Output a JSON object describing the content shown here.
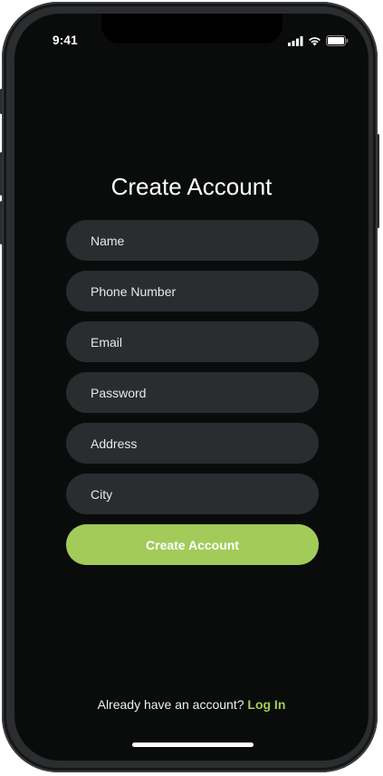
{
  "status_bar": {
    "time": "9:41",
    "icons": [
      "signal-icon",
      "wifi-icon",
      "battery-icon"
    ]
  },
  "form": {
    "title": "Create Account",
    "fields": [
      {
        "placeholder": "Name"
      },
      {
        "placeholder": "Phone Number"
      },
      {
        "placeholder": "Email"
      },
      {
        "placeholder": "Password"
      },
      {
        "placeholder": "Address"
      },
      {
        "placeholder": "City"
      }
    ],
    "submit_label": "Create Account"
  },
  "footer": {
    "prompt": "Already have an account?",
    "login_label": "Log In"
  },
  "colors": {
    "background": "#0a0c0c",
    "field_background": "#2a2d30",
    "accent": "#a2cb5a",
    "text": "#ffffff"
  }
}
